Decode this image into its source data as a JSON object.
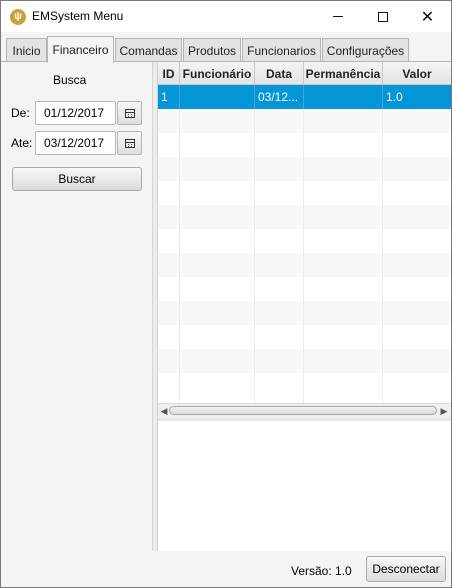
{
  "window": {
    "title": "EMSystem Menu",
    "icon": "fork-knife-icon"
  },
  "tabs": [
    {
      "label": "Inicio"
    },
    {
      "label": "Financeiro",
      "active": true
    },
    {
      "label": "Comandas"
    },
    {
      "label": "Produtos"
    },
    {
      "label": "Funcionarios"
    },
    {
      "label": "Configurações"
    }
  ],
  "search": {
    "heading": "Busca",
    "from_label": "De:",
    "from_value": "01/12/2017",
    "to_label": "Ate:",
    "to_value": "03/12/2017",
    "button_label": "Buscar"
  },
  "table": {
    "columns": [
      "ID",
      "Funcionário",
      "Data",
      "Permanência",
      "Valor"
    ],
    "rows": [
      [
        "1",
        "",
        "03/12...",
        "",
        "1.0"
      ]
    ],
    "selected_row": 0
  },
  "footer": {
    "version": "Versão: 1.0",
    "disconnect_label": "Desconectar"
  },
  "colors": {
    "selection": "#0596d7",
    "app_icon": "#c9a23a"
  }
}
